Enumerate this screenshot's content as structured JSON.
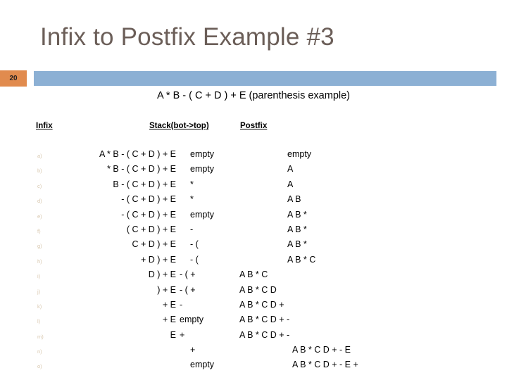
{
  "slide": {
    "title": "Infix to Postfix Example #3",
    "number": "20",
    "expression": "A * B - ( C + D ) + E (parenthesis example)",
    "accent_orange": "#e18b4e",
    "accent_blue": "#8cb0d4",
    "title_color": "#6b5e58",
    "marker_color": "#d8c7ae"
  },
  "table": {
    "headers": {
      "infix": "Infix",
      "stack": "Stack(bot->top)",
      "postfix": "Postfix"
    },
    "rows": [
      {
        "marker": "a)",
        "infix": "A * B - ( C + D ) + E",
        "stack": "empty",
        "postfix": "empty",
        "layout": "default"
      },
      {
        "marker": "b)",
        "infix": "* B - ( C + D ) + E",
        "stack": "empty",
        "postfix": "A",
        "layout": "default"
      },
      {
        "marker": "c)",
        "infix": "B - ( C + D ) + E",
        "stack": "*",
        "postfix": "A",
        "layout": "default"
      },
      {
        "marker": "d)",
        "infix": "- ( C + D ) + E",
        "stack": "*",
        "postfix": "A B",
        "layout": "default"
      },
      {
        "marker": "e)",
        "infix": "- ( C + D ) + E",
        "stack": "empty",
        "postfix": "A B *",
        "layout": "default"
      },
      {
        "marker": "f)",
        "infix": "( C + D ) + E",
        "stack": "-",
        "postfix": "A B *",
        "layout": "default"
      },
      {
        "marker": "g)",
        "infix": "C + D ) + E",
        "stack": "- (",
        "postfix": "A B *",
        "layout": "default"
      },
      {
        "marker": "h)",
        "infix": "+ D ) + E",
        "stack": "- (",
        "postfix": "A B * C",
        "layout": "default"
      },
      {
        "marker": "i)",
        "infix": "D ) + E",
        "stack": "- ( +",
        "postfix": "A B * C",
        "layout": "shifted"
      },
      {
        "marker": "j)",
        "infix": ") + E",
        "stack": "- ( +",
        "postfix": "A B * C D",
        "layout": "shifted"
      },
      {
        "marker": "k)",
        "infix": "+ E",
        "stack": "-",
        "postfix": "A B * C D +",
        "layout": "shifted"
      },
      {
        "marker": "l)",
        "infix": "+ E",
        "stack": "empty",
        "postfix": "A B * C D + -",
        "layout": "shifted"
      },
      {
        "marker": "m)",
        "infix": "E",
        "stack": "+",
        "postfix": "A B * C D + -",
        "layout": "shifted"
      },
      {
        "marker": "n)",
        "infix": "",
        "stack": "+",
        "postfix": "A B * C D + - E",
        "layout": "tail"
      },
      {
        "marker": "o)",
        "infix": "",
        "stack": "empty",
        "postfix": "A B * C D + - E +",
        "layout": "tail"
      }
    ]
  }
}
